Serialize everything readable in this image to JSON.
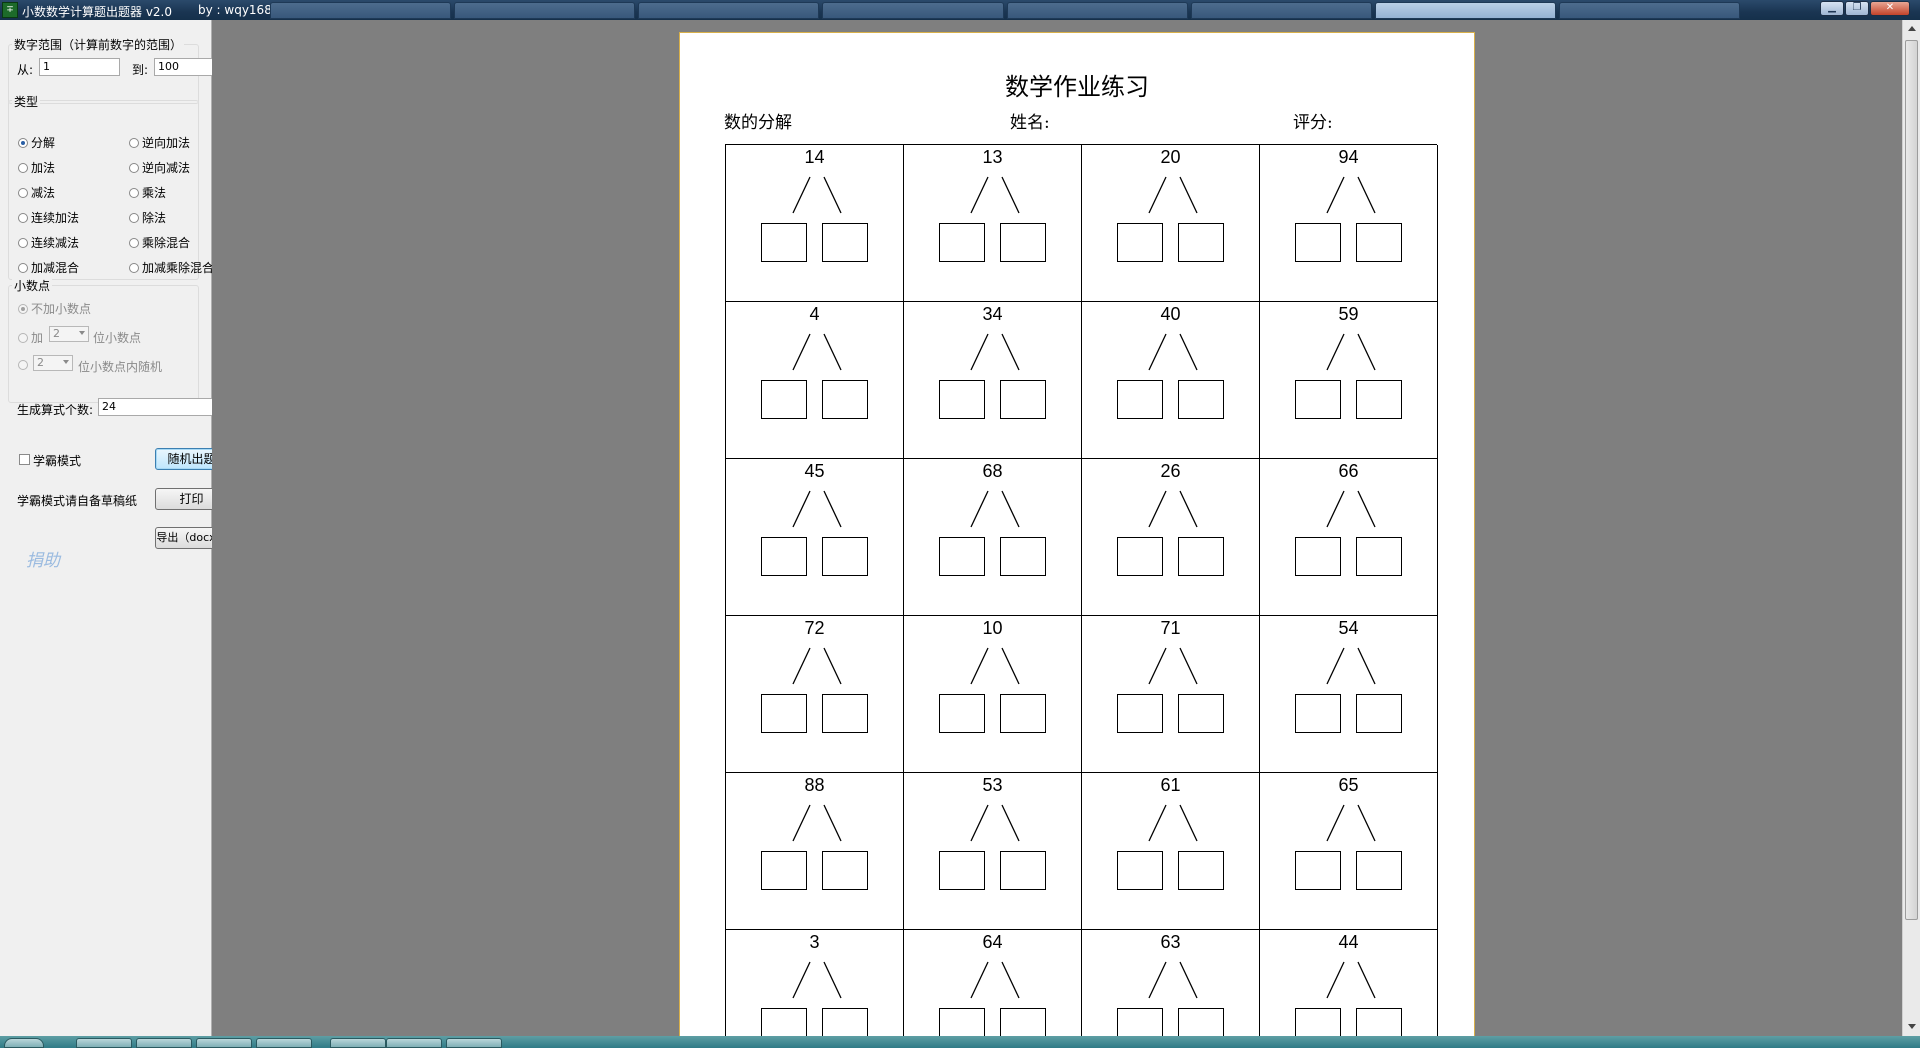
{
  "window": {
    "title": "小数数学计算题出题器 v2.0",
    "author": "by : wqy168",
    "icon_text": "∓"
  },
  "controls": {
    "range": {
      "group_label": "数字范围（计算前数字的范围）",
      "from_label": "从:",
      "from_value": "1",
      "to_label": "到:",
      "to_value": "100"
    },
    "type": {
      "group_label": "类型",
      "options": [
        {
          "label": "分解",
          "selected": true
        },
        {
          "label": "逆向加法",
          "selected": false
        },
        {
          "label": "加法",
          "selected": false
        },
        {
          "label": "逆向减法",
          "selected": false
        },
        {
          "label": "减法",
          "selected": false
        },
        {
          "label": "乘法",
          "selected": false
        },
        {
          "label": "连续加法",
          "selected": false
        },
        {
          "label": "除法",
          "selected": false
        },
        {
          "label": "连续减法",
          "selected": false
        },
        {
          "label": "乘除混合",
          "selected": false
        },
        {
          "label": "加减混合",
          "selected": false
        },
        {
          "label": "加减乘除混合",
          "selected": false
        }
      ]
    },
    "decimal": {
      "group_label": "小数点",
      "no_decimal": "不加小数点",
      "add_prefix": "加",
      "add_value": "2",
      "add_suffix": "位小数点",
      "random_value": "2",
      "random_suffix": "位小数点内随机"
    },
    "count": {
      "label": "生成算式个数:",
      "value": "24"
    },
    "xueba": {
      "label": "学霸模式",
      "checked": false,
      "note": "学霸模式请自备草稿纸"
    },
    "buttons": {
      "random": "随机出题",
      "print": "打印",
      "export": "导出（docx）"
    },
    "donate": "捐助"
  },
  "worksheet": {
    "title": "数学作业练习",
    "subtitle": "数的分解",
    "name_label": "姓名:",
    "score_label": "评分:",
    "rows": [
      [
        "14",
        "13",
        "20",
        "94"
      ],
      [
        "4",
        "34",
        "40",
        "59"
      ],
      [
        "45",
        "68",
        "26",
        "66"
      ],
      [
        "72",
        "10",
        "71",
        "54"
      ],
      [
        "88",
        "53",
        "61",
        "65"
      ],
      [
        "3",
        "64",
        "63",
        "44"
      ]
    ]
  },
  "colors": {
    "titlebar": "#1a3552",
    "panel": "#f0f0f0",
    "workspace": "#7f7f7f",
    "page_border": "#d8b04a",
    "focus_button": "#bee6fd"
  }
}
